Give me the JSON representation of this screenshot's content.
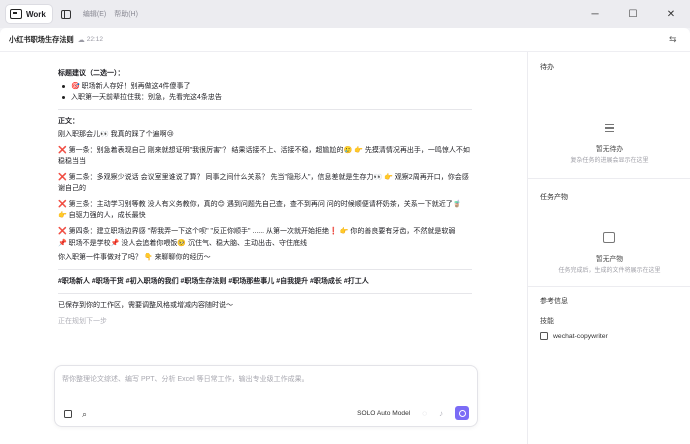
{
  "app": {
    "name": "Work",
    "menu": [
      "编辑(E)",
      "帮助(H)"
    ]
  },
  "header": {
    "title": "小红书职场生存法则",
    "time": "22:12"
  },
  "content": {
    "heading_title": "标题建议（二选一）：",
    "titles": [
      "🎯 职场新人存好！别再做这4件傻事了",
      "入职第一天前辈拉住我：别急，先看完这4条忠告"
    ],
    "body_label": "正文：",
    "intro": "刚入职那会儿👀 我真的踩了个遍啊😢",
    "rules": [
      {
        "mark": "❌",
        "text": "第一条：别急着表现自己 刚来就想证明\"我很厉害\"？ 结果话接不上、活接不稳，超尴尬的🥲 👉 先摸清情况再出手，一鸣惊人不如稳稳当当"
      },
      {
        "mark": "❌",
        "text": "第二条：多观察少说话 会议室里谁说了算？ 同事之间什么关系？ 先当\"隐形人\"，信息差就是生存力👀 👉 观察2周再开口，你会感谢自己的"
      },
      {
        "mark": "❌",
        "text": "第三条：主动学习别等教 没人有义务教你，真的😊 遇到问题先自己查，查不到再问 问的时候顺便请杯奶茶，关系一下就近了🧋 👉 自驱力强的人，成长最快"
      },
      {
        "mark": "❌",
        "text": "第四条：建立职场边界感 \"帮我弄一下这个呗\" \"反正你顺手\" ...... 从第一次就开始拒绝❗ 👉 你的善良要有牙齿，不然就是软弱"
      },
      {
        "mark": "📌",
        "text": "职场不是学校📌 没人会追着你喂饭🥺 沉住气、稳大脑、主动出击、守住底线"
      }
    ],
    "question": "你入职第一件事做对了吗？ 👇 来聊聊你的经历～",
    "hashtags": "#职场新人 #职场干货 #初入职场的我们 #职场生存法则 #职场那些事儿 #自我提升 #职场成长 #打工人",
    "saved_note": "已保存到你的工作区，需要调整风格或增减内容随时说～",
    "status": "正在规划下一步"
  },
  "composer": {
    "placeholder": "帮你整理论文综述、编写 PPT、分析 Excel 等日常工作，输出专业级工作成果。",
    "model": "SOLO Auto Model"
  },
  "sidebar": {
    "todo_title": "待办",
    "todo_empty": "暂无待办",
    "todo_desc": "复杂任务的进展会显示在这里",
    "artifacts_title": "任务产物",
    "artifacts_empty": "暂无产物",
    "artifacts_desc": "任务完成后，生成的文件将展示在这里",
    "ref_title": "参考信息",
    "skills_label": "技能",
    "skill_item": "wechat-copywriter"
  }
}
